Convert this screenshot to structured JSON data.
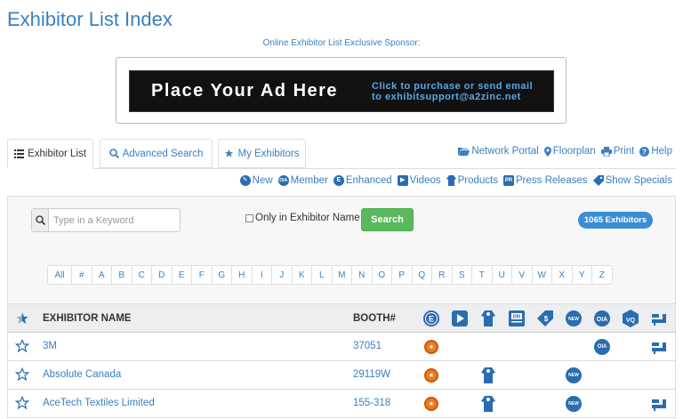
{
  "page_title": "Exhibitor List Index",
  "sponsor_label": "Online Exhibitor List Exclusive Sponsor:",
  "ad": {
    "main": "Place Your Ad Here",
    "line1": "Click to purchase or send email",
    "line2": "to exhibitsupport@a2zinc.net"
  },
  "tabs": [
    {
      "label": "Exhibitor List",
      "icon": "list-icon",
      "active": true
    },
    {
      "label": "Advanced Search",
      "icon": "search-icon",
      "active": false
    },
    {
      "label": "My Exhibitors",
      "icon": "star-icon",
      "active": false
    }
  ],
  "top_links": [
    {
      "label": "Network Portal",
      "icon": "folder-icon"
    },
    {
      "label": "Floorplan",
      "icon": "map-marker-icon"
    },
    {
      "label": "Print",
      "icon": "print-icon"
    },
    {
      "label": "Help",
      "icon": "help-icon"
    }
  ],
  "legend": [
    {
      "label": "New",
      "icon": "new-icon"
    },
    {
      "label": "Member",
      "icon": "member-icon",
      "badge": "OIA"
    },
    {
      "label": "Enhanced",
      "icon": "enhanced-icon",
      "badge": "E"
    },
    {
      "label": "Videos",
      "icon": "video-icon"
    },
    {
      "label": "Products",
      "icon": "products-icon"
    },
    {
      "label": "Press Releases",
      "icon": "press-release-icon",
      "badge": "PR"
    },
    {
      "label": "Show Specials",
      "icon": "tag-icon"
    }
  ],
  "search": {
    "placeholder": "Type in a Keyword",
    "checkbox_label": "Only in Exhibitor Name",
    "button_label": "Search"
  },
  "count_badge": "1065  Exhibitors",
  "alphabet": [
    "All",
    "#",
    "A",
    "B",
    "C",
    "D",
    "E",
    "F",
    "G",
    "H",
    "I",
    "J",
    "K",
    "L",
    "M",
    "N",
    "O",
    "P",
    "Q",
    "R",
    "S",
    "T",
    "U",
    "V",
    "W",
    "X",
    "Y",
    "Z"
  ],
  "table": {
    "header_name": "EXHIBITOR NAME",
    "header_booth": "BOOTH#",
    "header_icons": [
      "enhanced-icon",
      "video-icon",
      "products-icon",
      "press-release-icon",
      "show-specials-icon",
      "new-icon",
      "member-icon",
      "sewing-icon",
      "machine-icon"
    ],
    "rows": [
      {
        "name": "3M",
        "booth": "37051",
        "icons": [
          "enhanced",
          "member",
          "machine"
        ]
      },
      {
        "name": "Absolute Canada",
        "booth": "29119W",
        "icons": [
          "enhanced",
          "products",
          "new"
        ]
      },
      {
        "name": "AceTech Textiles Limited",
        "booth": "155-318",
        "icons": [
          "enhanced",
          "products",
          "new",
          "machine"
        ]
      }
    ]
  },
  "colors": {
    "link_blue": "#3a7fc1",
    "icon_blue": "#2b6cb0",
    "search_green": "#5cb85c",
    "enhanced_orange": "#e67e22"
  }
}
